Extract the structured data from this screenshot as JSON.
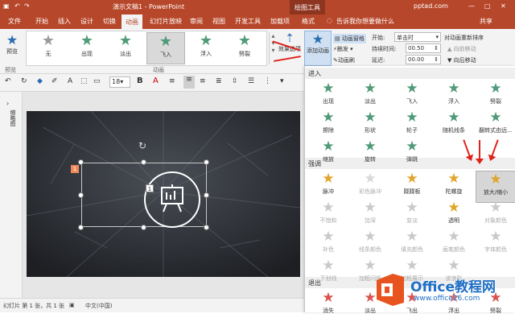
{
  "titlebar": {
    "document_title": "演示文稿1 - PowerPoint",
    "context_tab_group": "绘图工具",
    "account": "pptad.com",
    "controls": {
      "minimize": "—",
      "restore": "□",
      "close": "✕"
    }
  },
  "tabs": [
    "文件",
    "开始",
    "插入",
    "设计",
    "切换",
    "动画",
    "幻灯片放映",
    "审阅",
    "视图",
    "开发工具",
    "加载项",
    "格式"
  ],
  "active_tab": "动画",
  "tell_me": "告诉我你想要做什么",
  "share": "共享",
  "ribbon": {
    "preview_label": "预览",
    "preview_group": "预览",
    "effects": [
      {
        "name": "无",
        "icon": "star-none-icon",
        "color": "#9a9a9a"
      },
      {
        "name": "出现",
        "icon": "star-appear-icon",
        "color": "#4f9a78"
      },
      {
        "name": "淡出",
        "icon": "star-fade-icon",
        "color": "#4f9a78"
      },
      {
        "name": "飞入",
        "icon": "star-flyin-icon",
        "color": "#4f9a78"
      },
      {
        "name": "浮入",
        "icon": "star-floatin-icon",
        "color": "#4f9a78"
      },
      {
        "name": "劈裂",
        "icon": "star-split-icon",
        "color": "#4f9a78"
      }
    ],
    "selected_effect": "飞入",
    "animation_group": "动画",
    "effect_options": "效果选项",
    "add_animation": "添加动画",
    "animation_pane": "动画窗格",
    "trigger": "触发",
    "animation_painter": "动画刷",
    "start_label": "开始:",
    "start_value": "单击时",
    "duration_label": "持续时间:",
    "duration_value": "00.50",
    "delay_label": "延迟:",
    "delay_value": "00.00",
    "reorder_title": "对动画重新排序",
    "move_earlier": "向前移动",
    "move_later": "向后移动"
  },
  "toolbar2": {
    "font_size": "18"
  },
  "left_panel_label": "缩略图",
  "slide": {
    "badge1": "1",
    "badge2": "1"
  },
  "status": {
    "slide_info": "幻灯片 第 1 张，共 1 张",
    "language": "中文(中国)"
  },
  "dropdown": {
    "sections": [
      {
        "title": "进入",
        "items": [
          {
            "label": "出现",
            "color": "#4f9a78",
            "dim": false
          },
          {
            "label": "淡出",
            "color": "#4f9a78",
            "dim": false
          },
          {
            "label": "飞入",
            "color": "#4f9a78",
            "dim": false
          },
          {
            "label": "浮入",
            "color": "#4f9a78",
            "dim": false
          },
          {
            "label": "劈裂",
            "color": "#4f9a78",
            "dim": false
          },
          {
            "label": "擦除",
            "color": "#4f9a78",
            "dim": false
          },
          {
            "label": "形状",
            "color": "#4f9a78",
            "dim": false
          },
          {
            "label": "轮子",
            "color": "#4f9a78",
            "dim": false
          },
          {
            "label": "随机线条",
            "color": "#4f9a78",
            "dim": false
          },
          {
            "label": "翻转式由远...",
            "color": "#4f9a78",
            "dim": false
          },
          {
            "label": "缩放",
            "color": "#4f9a78",
            "dim": false
          },
          {
            "label": "旋转",
            "color": "#4f9a78",
            "dim": false
          },
          {
            "label": "弹跳",
            "color": "#4f9a78",
            "dim": false
          }
        ]
      },
      {
        "title": "强调",
        "items": [
          {
            "label": "脉冲",
            "color": "#e0a52a",
            "dim": false
          },
          {
            "label": "彩色脉冲",
            "color": "#d9d9d9",
            "dim": true
          },
          {
            "label": "跷跷板",
            "color": "#e0a52a",
            "dim": false
          },
          {
            "label": "陀螺旋",
            "color": "#e0a52a",
            "dim": false
          },
          {
            "label": "放大/缩小",
            "color": "#e0a52a",
            "dim": false
          },
          {
            "label": "不饱和",
            "color": "#c9c9c9",
            "dim": true
          },
          {
            "label": "加深",
            "color": "#c9c9c9",
            "dim": true
          },
          {
            "label": "变淡",
            "color": "#c9c9c9",
            "dim": true
          },
          {
            "label": "透明",
            "color": "#e0a52a",
            "dim": false
          },
          {
            "label": "对象颜色",
            "color": "#c9c9c9",
            "dim": true
          },
          {
            "label": "补色",
            "color": "#c9c9c9",
            "dim": true
          },
          {
            "label": "线条颜色",
            "color": "#c9c9c9",
            "dim": true
          },
          {
            "label": "填充颜色",
            "color": "#c9c9c9",
            "dim": true
          },
          {
            "label": "画笔颜色",
            "color": "#c9c9c9",
            "dim": true
          },
          {
            "label": "字体颜色",
            "color": "#c9c9c9",
            "dim": true
          },
          {
            "label": "下划线",
            "color": "#c9c9c9",
            "dim": true
          },
          {
            "label": "加粗闪烁",
            "color": "#c9c9c9",
            "dim": true
          },
          {
            "label": "加粗展示",
            "color": "#c9c9c9",
            "dim": true
          },
          {
            "label": "波浪形",
            "color": "#c9c9c9",
            "dim": true
          }
        ]
      },
      {
        "title": "退出",
        "items": [
          {
            "label": "消失",
            "color": "#d9534f",
            "dim": false
          },
          {
            "label": "淡出",
            "color": "#d9534f",
            "dim": false
          },
          {
            "label": "飞出",
            "color": "#d9534f",
            "dim": false
          },
          {
            "label": "浮出",
            "color": "#d9534f",
            "dim": false
          },
          {
            "label": "劈裂",
            "color": "#d9534f",
            "dim": false
          }
        ]
      }
    ],
    "highlighted": "放大/缩小"
  },
  "watermark": {
    "brand": "Office教程网",
    "url": "www.office26.com"
  },
  "colors": {
    "accent": "#b7472a",
    "arrow": "#e0211b",
    "slide_bg": "#2e3035"
  }
}
